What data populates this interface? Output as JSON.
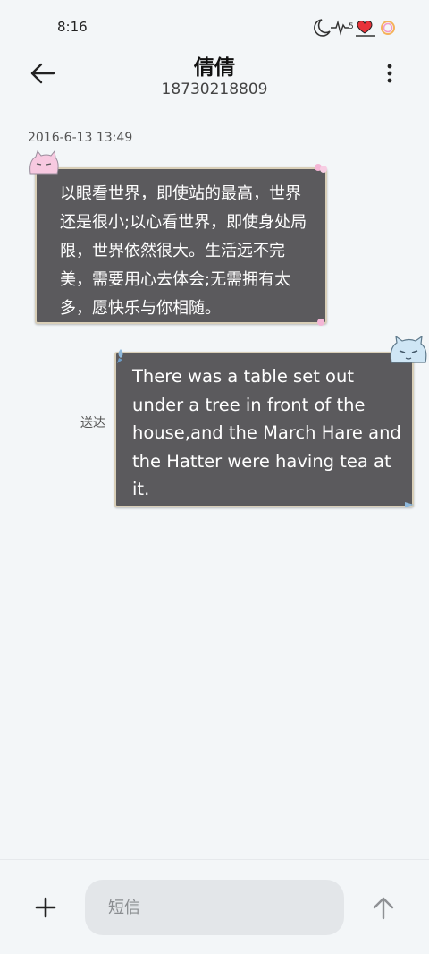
{
  "status_bar": {
    "time": "8:16",
    "battery_level": "5",
    "icons": [
      "moon-icon",
      "heartbeat-icon",
      "heart-icon",
      "ring-icon"
    ]
  },
  "header": {
    "name": "倩倩",
    "number": "18730218809",
    "back_icon": "arrow-left-icon",
    "more_icon": "more-vertical-icon"
  },
  "thread": {
    "timestamp": "2016-6-13 13:49",
    "messages": [
      {
        "direction": "incoming",
        "text": "以眼看世界，即使站的最高，世界还是很小;以心看世界，即使身处局限，世界依然很大。生活远不完美，需要用心去体会;无需拥有太多，愿快乐与你相随。"
      },
      {
        "direction": "outgoing",
        "text": "There was a table set out under a tree in front of the house,and the March Hare and the Hatter were having tea at it.",
        "status": "送达"
      }
    ]
  },
  "composer": {
    "placeholder": "短信",
    "add_icon": "plus-icon",
    "send_icon": "arrow-up-icon"
  },
  "colors": {
    "background": "#f3f6f8",
    "bubble": "#5b5a5d",
    "bubble_border": "#d9cfb8",
    "heart": "#e8333a"
  }
}
